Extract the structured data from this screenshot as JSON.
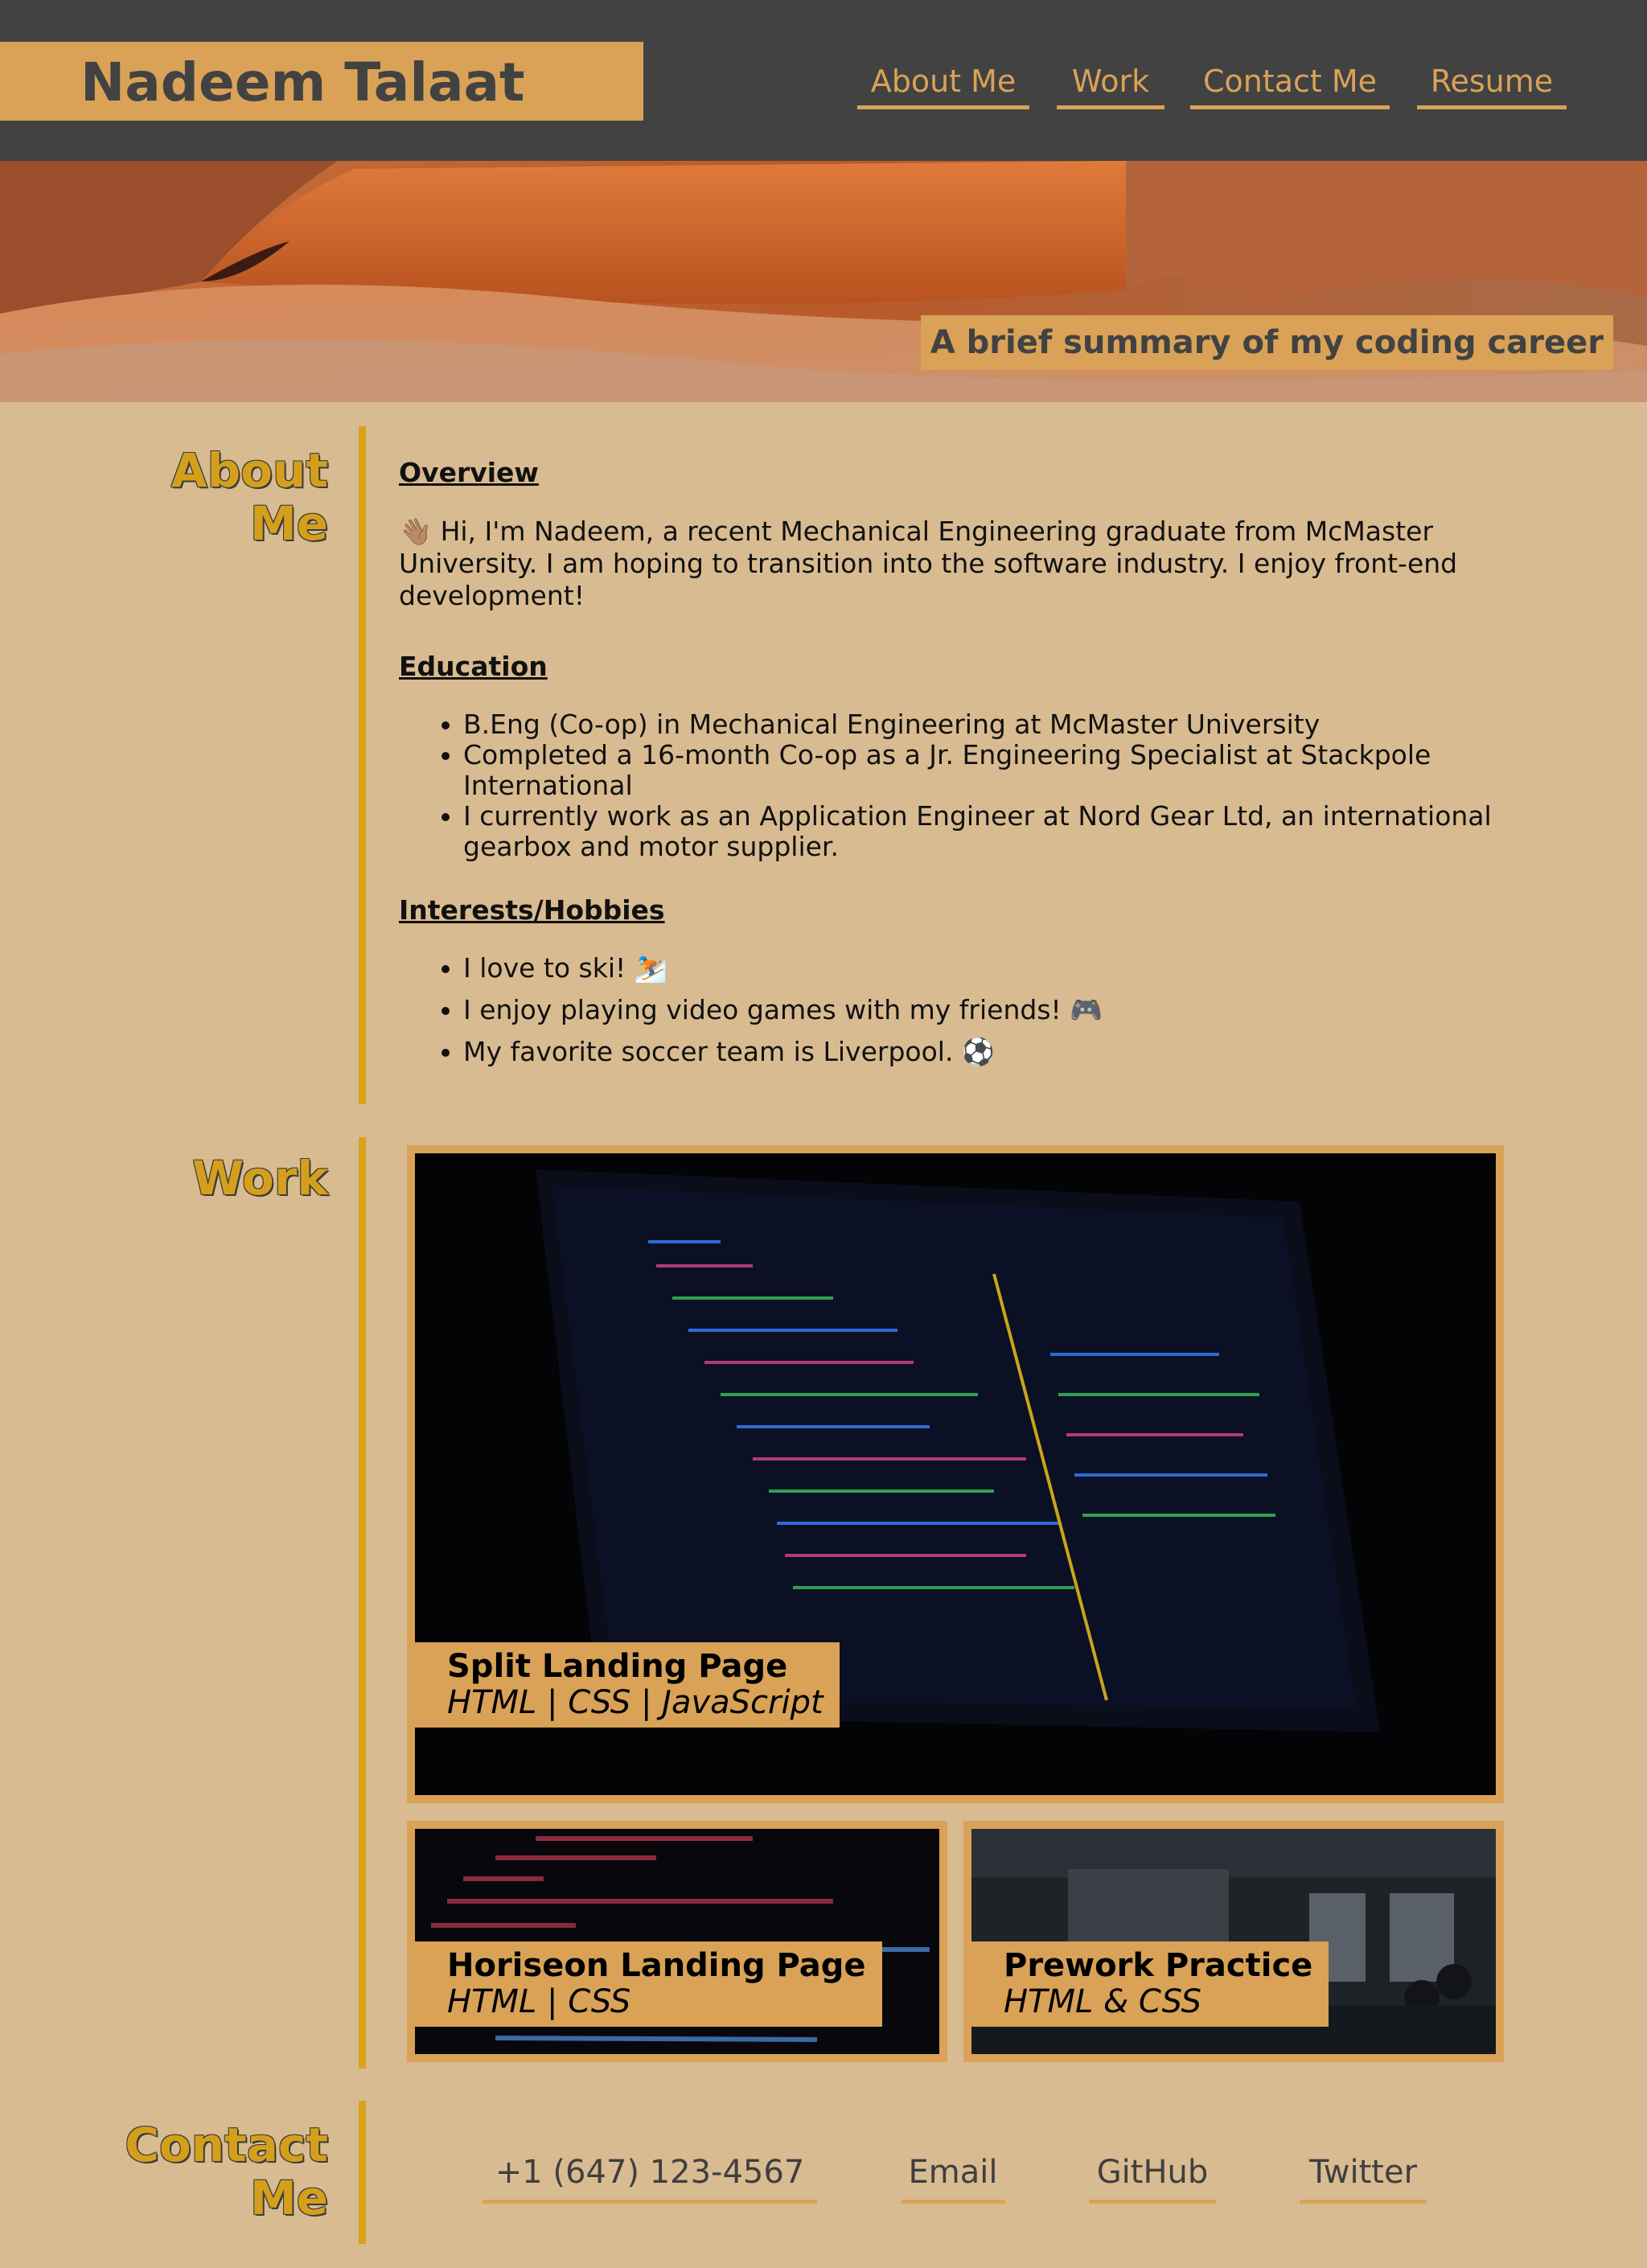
{
  "header": {
    "name": "Nadeem Talaat",
    "nav": [
      "About Me",
      "Work",
      "Contact Me",
      "Resume"
    ]
  },
  "hero": {
    "tagline": "A brief summary of my coding career"
  },
  "about": {
    "title_line1": "About",
    "title_line2": "Me",
    "overview_heading": "Overview",
    "overview_text": "👋🏽 Hi, I'm Nadeem, a recent Mechanical Engineering graduate from McMaster University. I am hoping to transition into the software industry. I enjoy front-end development!",
    "education_heading": "Education",
    "education": [
      "B.Eng (Co-op) in Mechanical Engineering at McMaster University",
      "Completed a 16-month Co-op as a Jr. Engineering Specialist at Stackpole International",
      "I currently work as an Application Engineer at Nord Gear Ltd, an international gearbox and motor supplier."
    ],
    "hobbies_heading": "Interests/Hobbies",
    "hobbies": [
      "I love to ski! ⛷️",
      "I enjoy playing video games with my friends! 🎮",
      "My favorite soccer team is Liverpool. ⚽"
    ]
  },
  "work": {
    "title": "Work",
    "projects": [
      {
        "title": "Split Landing Page",
        "tech": "HTML | CSS | JavaScript"
      },
      {
        "title": "Horiseon Landing Page",
        "tech": "HTML | CSS"
      },
      {
        "title": "Prework Practice",
        "tech": "HTML & CSS"
      }
    ]
  },
  "contact": {
    "title_line1": "Contact",
    "title_line2": "Me",
    "links": [
      "+1 (647) 123-4567",
      "Email",
      "GitHub",
      "Twitter"
    ]
  },
  "colors": {
    "page_bg": "#d9bb91",
    "header_bg": "#424242",
    "accent": "#d9a257",
    "section_title": "#d4a01c"
  }
}
